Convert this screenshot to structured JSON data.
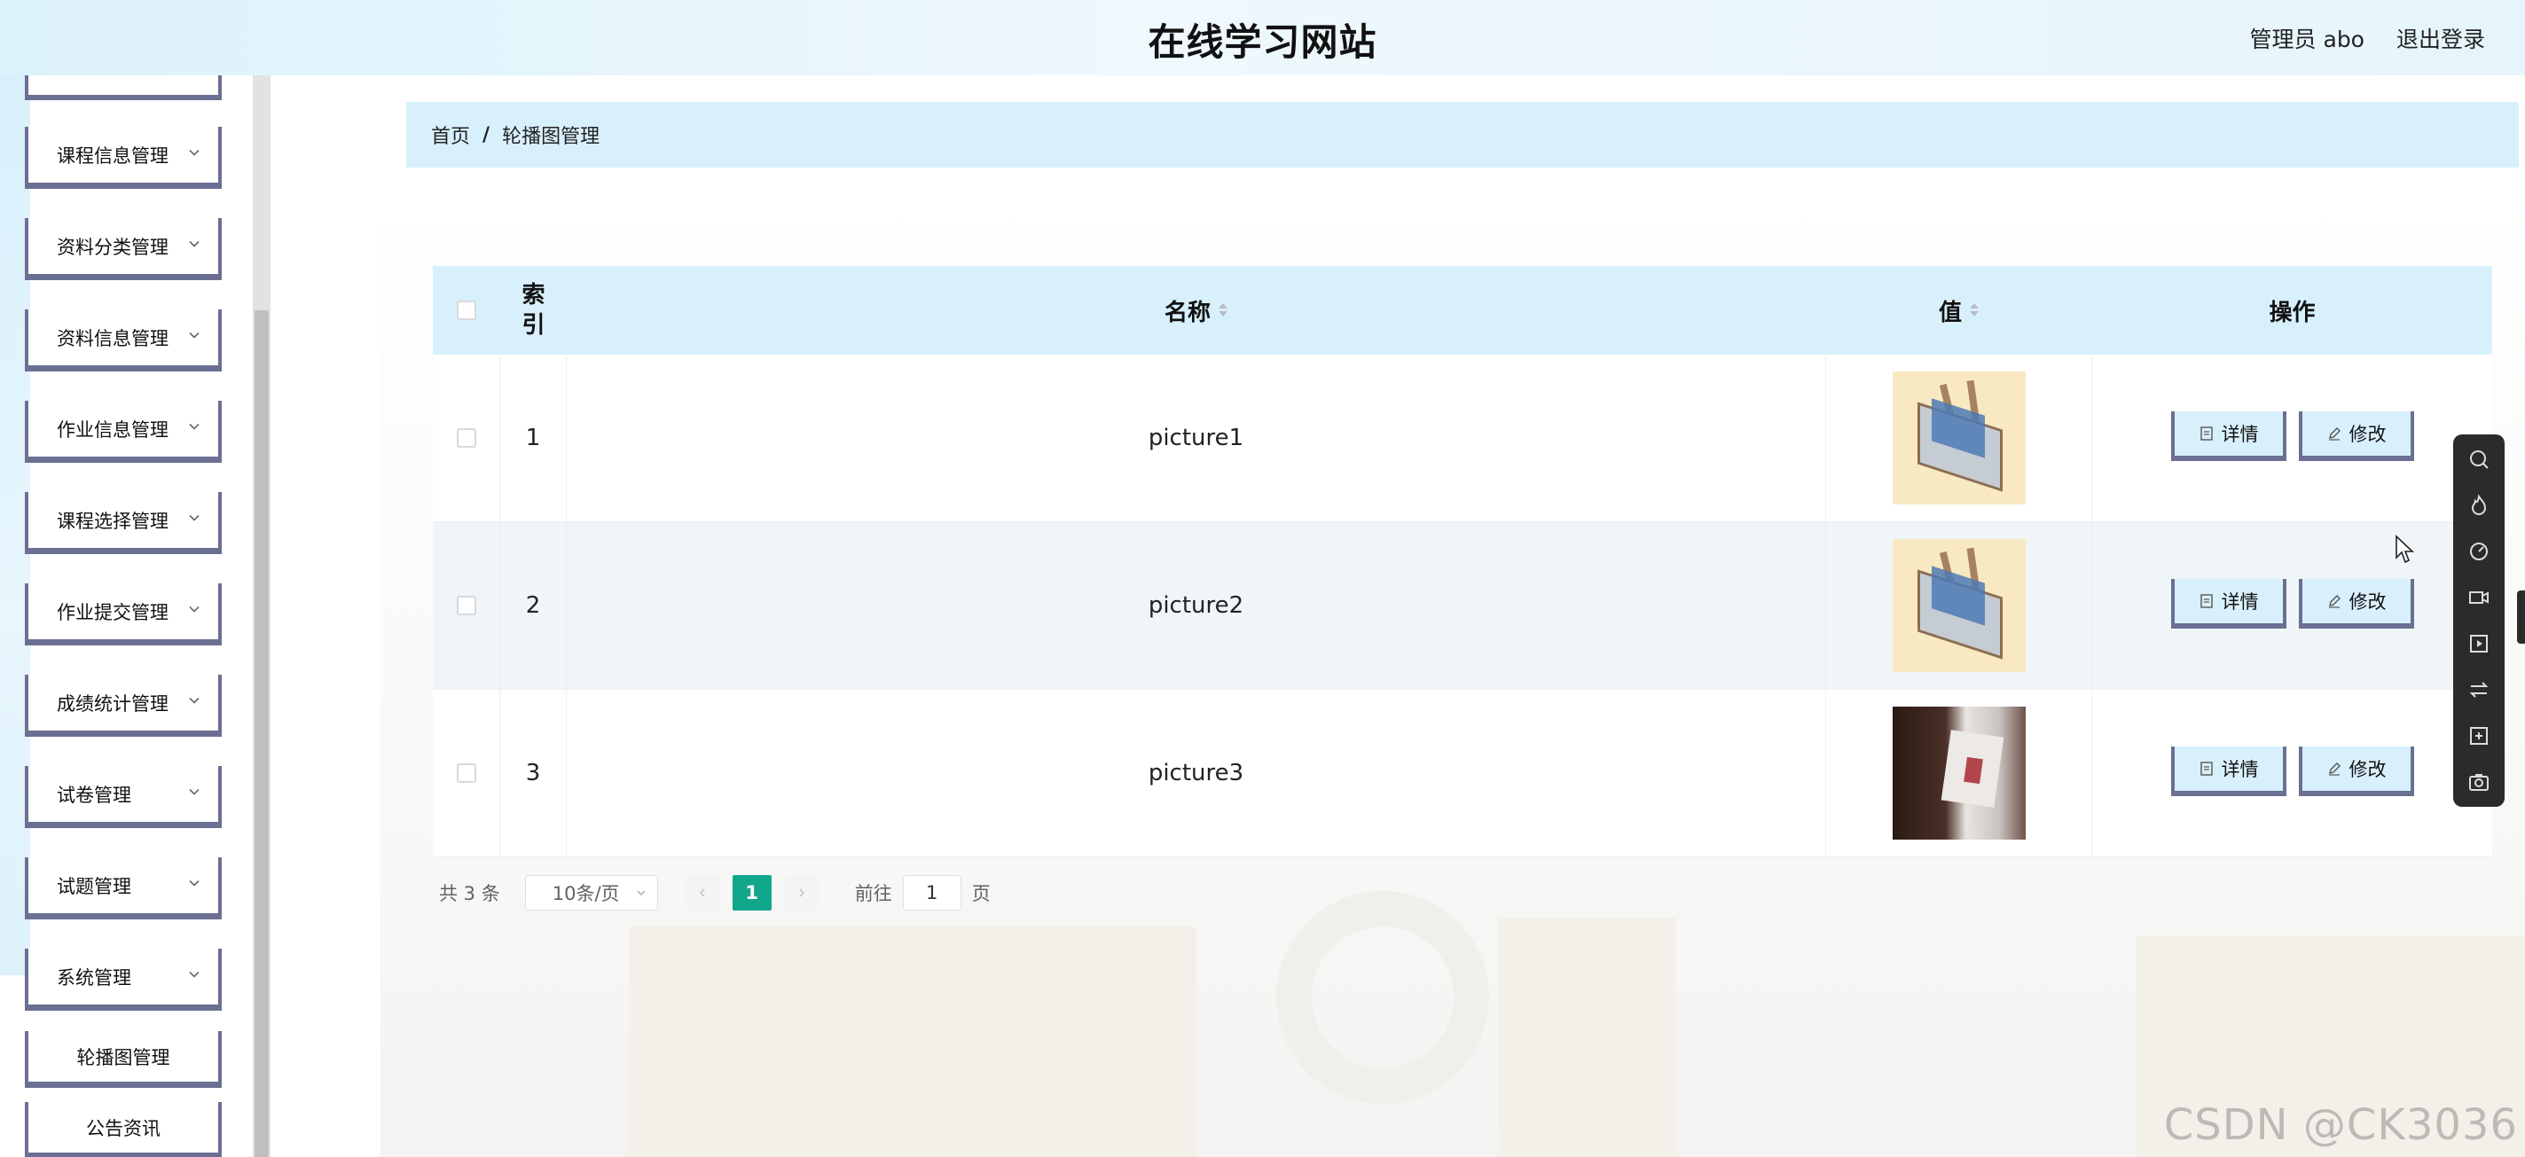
{
  "header": {
    "title": "在线学习网站",
    "admin_label": "管理员 abo",
    "logout_label": "退出登录"
  },
  "sidebar": {
    "items": [
      {
        "label": ""
      },
      {
        "label": "课程信息管理"
      },
      {
        "label": "资料分类管理"
      },
      {
        "label": "资料信息管理"
      },
      {
        "label": "作业信息管理"
      },
      {
        "label": "课程选择管理"
      },
      {
        "label": "作业提交管理"
      },
      {
        "label": "成绩统计管理"
      },
      {
        "label": "试卷管理"
      },
      {
        "label": "试题管理"
      },
      {
        "label": "系统管理"
      }
    ],
    "sub_items": [
      {
        "label": "轮播图管理"
      },
      {
        "label": "公告资讯"
      }
    ]
  },
  "breadcrumb": {
    "home": "首页",
    "separator": "/",
    "current": "轮播图管理"
  },
  "table": {
    "headers": {
      "index": "索引",
      "index_line1": "索",
      "index_line2": "引",
      "name": "名称",
      "value": "值",
      "ops": "操作"
    },
    "rows": [
      {
        "index": "1",
        "name": "picture1",
        "image": "book-illustration"
      },
      {
        "index": "2",
        "name": "picture2",
        "image": "book-illustration"
      },
      {
        "index": "3",
        "name": "picture3",
        "image": "book-photo"
      }
    ],
    "detail_label": "详情",
    "edit_label": "修改"
  },
  "pagination": {
    "total": "共 3 条",
    "page_size": "10条/页",
    "current_page": "1",
    "goto_prefix": "前往",
    "goto_value": "1",
    "goto_suffix": "页"
  },
  "watermark": "CSDN @CK3036",
  "colors": {
    "header_bg": "#dcf2fb",
    "accent_light": "#d8f0fc",
    "border_dark": "#6b6f93",
    "page_active": "#12a68a",
    "float_bar": "#2b2b2b"
  },
  "icons": {
    "menu_chevron": "chevron-down-icon",
    "detail": "document-icon",
    "edit": "pencil-icon",
    "toolbar": [
      "search-icon",
      "fire-icon",
      "speed-icon",
      "video-icon",
      "play-icon",
      "swap-icon",
      "crop-icon",
      "camera-icon"
    ]
  }
}
